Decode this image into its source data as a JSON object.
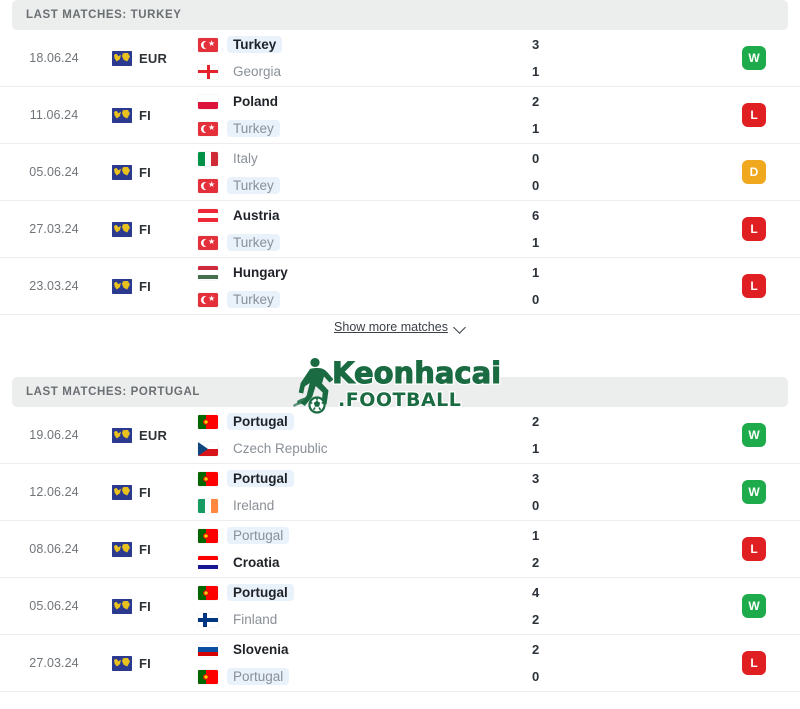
{
  "sections": [
    {
      "id": "turkey",
      "header": "LAST MATCHES: TURKEY",
      "focus_team": "Turkey",
      "matches": [
        {
          "date": "18.06.24",
          "competition": "EUR",
          "competition_icon": "uefa-euro-icon",
          "home": {
            "team": "Turkey",
            "flag": "turkey",
            "score": "3",
            "bold": true,
            "highlight": true
          },
          "away": {
            "team": "Georgia",
            "flag": "georgia",
            "score": "1",
            "bold": false,
            "highlight": false
          },
          "result": "W"
        },
        {
          "date": "11.06.24",
          "competition": "FI",
          "competition_icon": "friendly-international-icon",
          "home": {
            "team": "Poland",
            "flag": "poland",
            "score": "2",
            "bold": true,
            "highlight": false
          },
          "away": {
            "team": "Turkey",
            "flag": "turkey",
            "score": "1",
            "bold": false,
            "highlight": true
          },
          "result": "L"
        },
        {
          "date": "05.06.24",
          "competition": "FI",
          "competition_icon": "friendly-international-icon",
          "home": {
            "team": "Italy",
            "flag": "italy",
            "score": "0",
            "bold": false,
            "highlight": false
          },
          "away": {
            "team": "Turkey",
            "flag": "turkey",
            "score": "0",
            "bold": false,
            "highlight": true
          },
          "result": "D"
        },
        {
          "date": "27.03.24",
          "competition": "FI",
          "competition_icon": "friendly-international-icon",
          "home": {
            "team": "Austria",
            "flag": "austria",
            "score": "6",
            "bold": true,
            "highlight": false
          },
          "away": {
            "team": "Turkey",
            "flag": "turkey",
            "score": "1",
            "bold": false,
            "highlight": true
          },
          "result": "L"
        },
        {
          "date": "23.03.24",
          "competition": "FI",
          "competition_icon": "friendly-international-icon",
          "home": {
            "team": "Hungary",
            "flag": "hungary",
            "score": "1",
            "bold": true,
            "highlight": false
          },
          "away": {
            "team": "Turkey",
            "flag": "turkey",
            "score": "0",
            "bold": false,
            "highlight": true
          },
          "result": "L"
        }
      ]
    },
    {
      "id": "portugal",
      "header": "LAST MATCHES: PORTUGAL",
      "focus_team": "Portugal",
      "matches": [
        {
          "date": "19.06.24",
          "competition": "EUR",
          "competition_icon": "uefa-euro-icon",
          "home": {
            "team": "Portugal",
            "flag": "portugal",
            "score": "2",
            "bold": true,
            "highlight": true
          },
          "away": {
            "team": "Czech Republic",
            "flag": "czech",
            "score": "1",
            "bold": false,
            "highlight": false
          },
          "result": "W"
        },
        {
          "date": "12.06.24",
          "competition": "FI",
          "competition_icon": "friendly-international-icon",
          "home": {
            "team": "Portugal",
            "flag": "portugal",
            "score": "3",
            "bold": true,
            "highlight": true
          },
          "away": {
            "team": "Ireland",
            "flag": "ireland",
            "score": "0",
            "bold": false,
            "highlight": false
          },
          "result": "W"
        },
        {
          "date": "08.06.24",
          "competition": "FI",
          "competition_icon": "friendly-international-icon",
          "home": {
            "team": "Portugal",
            "flag": "portugal",
            "score": "1",
            "bold": false,
            "highlight": true
          },
          "away": {
            "team": "Croatia",
            "flag": "croatia",
            "score": "2",
            "bold": true,
            "highlight": false
          },
          "result": "L"
        },
        {
          "date": "05.06.24",
          "competition": "FI",
          "competition_icon": "friendly-international-icon",
          "home": {
            "team": "Portugal",
            "flag": "portugal",
            "score": "4",
            "bold": true,
            "highlight": true
          },
          "away": {
            "team": "Finland",
            "flag": "finland",
            "score": "2",
            "bold": false,
            "highlight": false
          },
          "result": "W"
        },
        {
          "date": "27.03.24",
          "competition": "FI",
          "competition_icon": "friendly-international-icon",
          "home": {
            "team": "Slovenia",
            "flag": "slovenia",
            "score": "2",
            "bold": true,
            "highlight": false
          },
          "away": {
            "team": "Portugal",
            "flag": "portugal",
            "score": "0",
            "bold": false,
            "highlight": true
          },
          "result": "L"
        }
      ]
    }
  ],
  "show_more": {
    "label": "Show more matches",
    "icon": "chevron-down-icon"
  },
  "watermark": {
    "brand": "Keonhacai",
    "suffix": ".FOOTBALL",
    "icon": "football-player-icon",
    "color": "#1a6b42"
  },
  "colors": {
    "win": "#1eab4b",
    "loss": "#e01f22",
    "draw": "#f0a81e",
    "header_bg": "#eceded",
    "highlight_bg": "#e9f1fb"
  }
}
